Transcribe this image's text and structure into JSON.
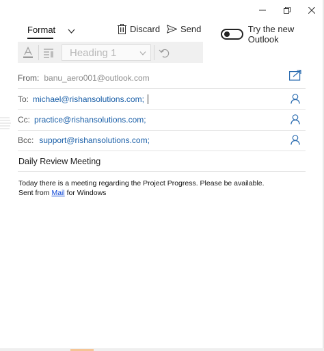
{
  "window": {
    "minimize": "minimize",
    "restore": "restore",
    "close": "close"
  },
  "toolbar": {
    "format_tab": "Format",
    "discard_label": "Discard",
    "send_label": "Send",
    "try_outlook_label": "Try the new Outlook",
    "try_outlook_toggle_on": false
  },
  "format_bar": {
    "style_value": "Heading 1"
  },
  "compose": {
    "from_label": "From:",
    "from_value": "banu_aero001@outlook.com",
    "to_label": "To:",
    "to_value": "michael@rishansolutions.com;",
    "cc_label": "Cc:",
    "cc_value": "practice@rishansolutions.com;",
    "bcc_label": "Bcc:",
    "bcc_value": "support@rishansolutions.com;",
    "subject": "Daily Review Meeting",
    "body_line1": "Today there is a meeting regarding the Project Progress. Please be available.",
    "body_sent_prefix": "Sent from",
    "body_mail_link": "Mail",
    "body_sent_suffix": "for Windows"
  },
  "colors": {
    "accent": "#1a5fa8",
    "link": "#0b45d6",
    "icon_blue": "#2b6cb0"
  }
}
